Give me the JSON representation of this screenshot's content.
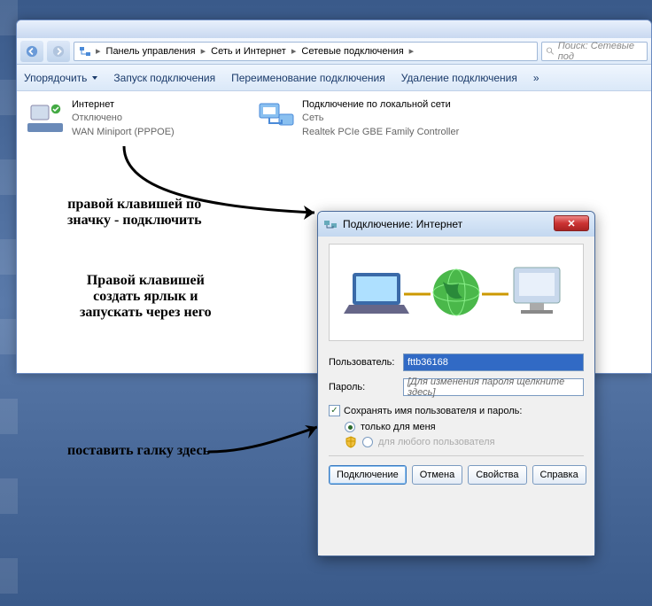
{
  "breadcrumb": {
    "items": [
      "Панель управления",
      "Сеть и Интернет",
      "Сетевые подключения"
    ]
  },
  "search": {
    "placeholder": "Поиск: Сетевые под"
  },
  "toolbar": {
    "organize": "Упорядочить",
    "start_conn": "Запуск подключения",
    "rename_conn": "Переименование подключения",
    "delete_conn": "Удаление подключения",
    "more": "»"
  },
  "connections": [
    {
      "title": "Интернет",
      "status": "Отключено",
      "device": "WAN Miniport (PPPOE)"
    },
    {
      "title": "Подключение по локальной сети",
      "status": "Сеть",
      "device": "Realtek PCIe GBE Family Controller"
    }
  ],
  "annotations": {
    "a1_line1": "правой клавишей по",
    "a1_line2": "значку - подключить",
    "a2_line1": "Правой клавишей",
    "a2_line2": "создать ярлык и",
    "a2_line3": "запускать через него",
    "a3": "поставить галку здесь"
  },
  "dialog": {
    "title": "Подключение: Интернет",
    "user_label": "Пользователь:",
    "user_value": "fttb36168",
    "pass_label": "Пароль:",
    "pass_placeholder": "[Для изменения пароля щелкните здесь]",
    "save_creds": "Сохранять имя пользователя и пароль:",
    "radio_me": "только для меня",
    "radio_all": "для любого пользователя",
    "btn_connect": "Подключение",
    "btn_cancel": "Отмена",
    "btn_props": "Свойства",
    "btn_help": "Справка"
  }
}
